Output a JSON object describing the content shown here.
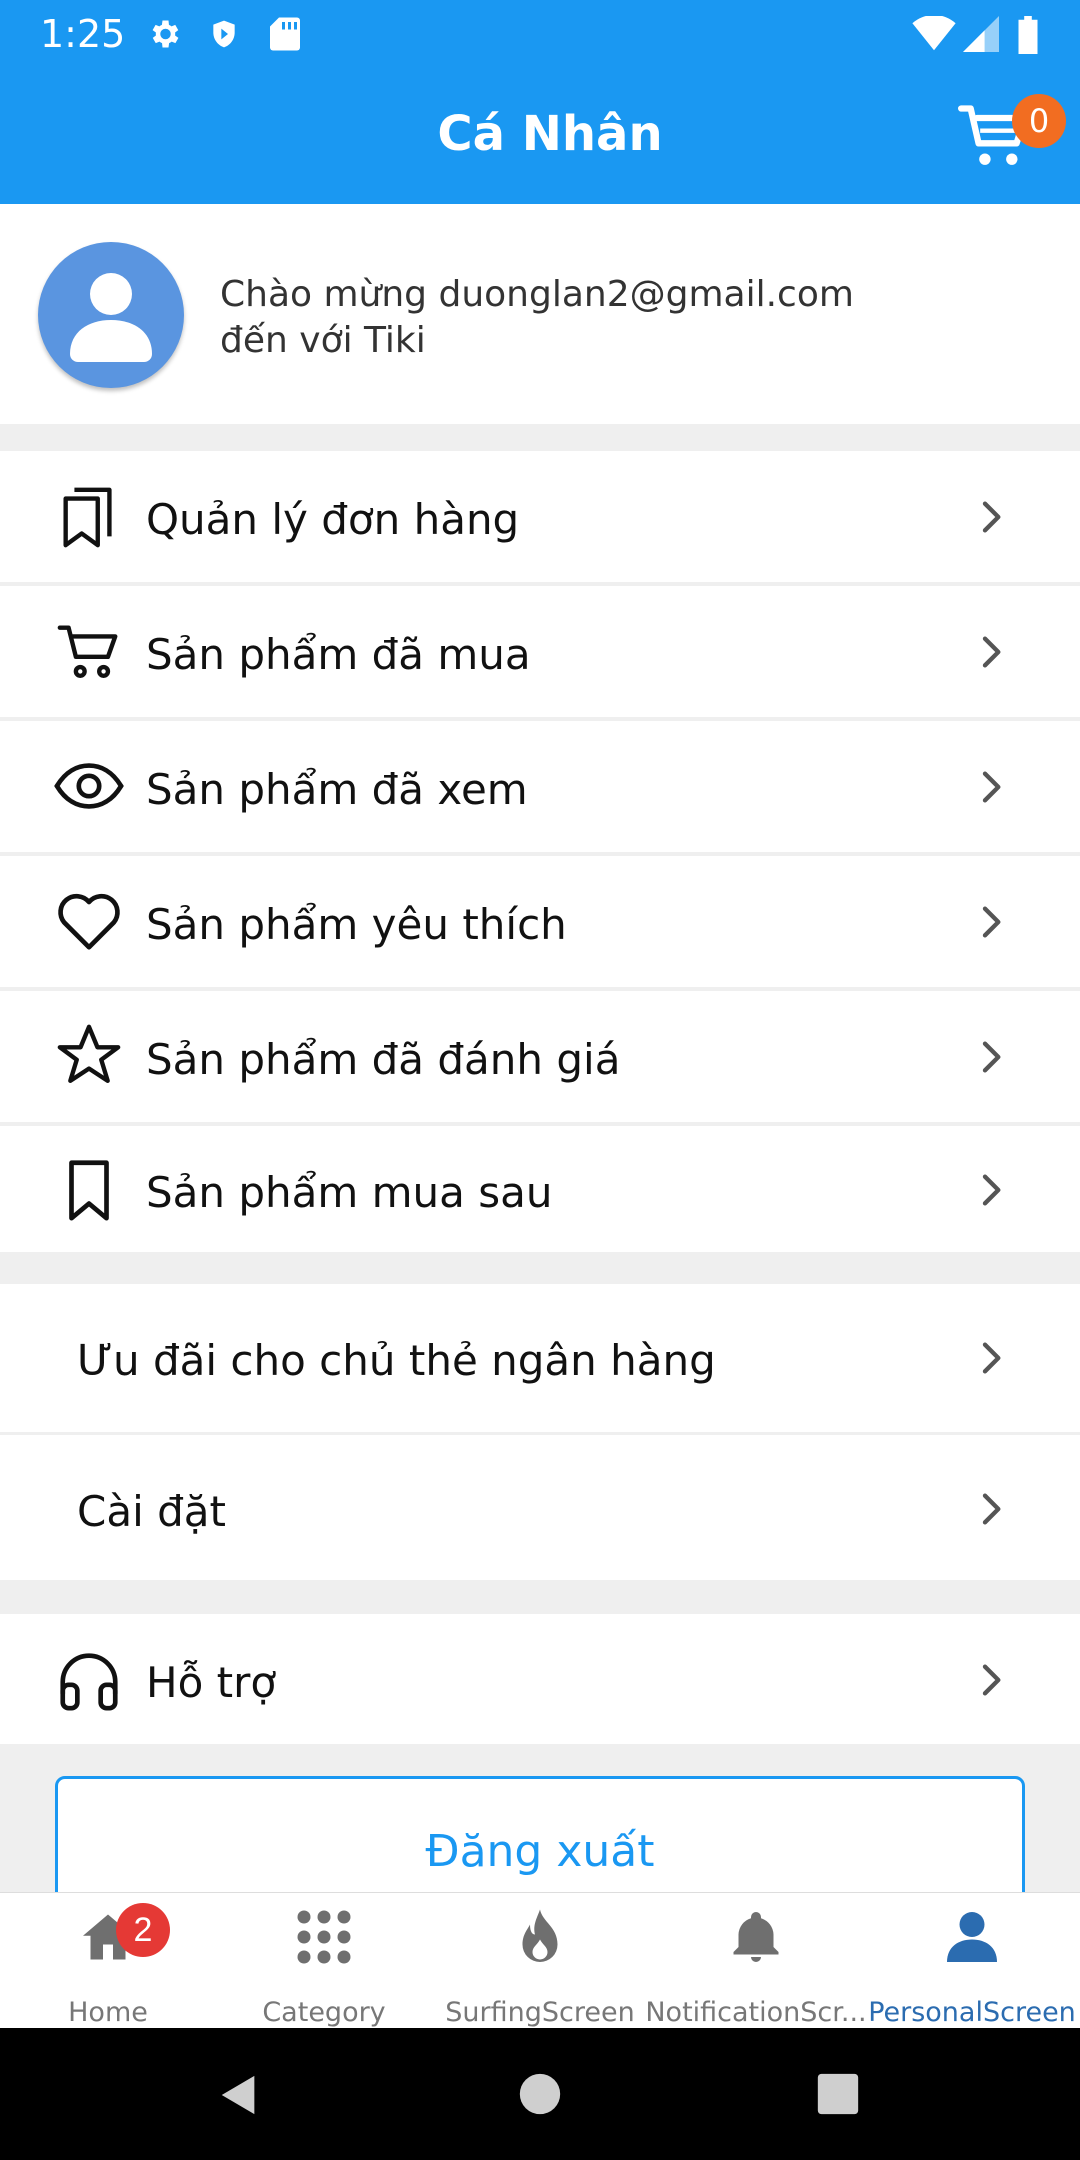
{
  "status_bar": {
    "time": "1:25",
    "left_icons": [
      "settings-icon",
      "shield-icon",
      "sd-card-icon"
    ],
    "right_icons": [
      "wifi-icon",
      "signal-icon",
      "battery-icon"
    ]
  },
  "header": {
    "title": "Cá Nhân",
    "cart_count": "0",
    "color": "#1a98f2"
  },
  "profile": {
    "welcome_line1": "Chào mừng duonglan2@gmail.com",
    "welcome_line2": "đến với Tiki"
  },
  "menu": {
    "orders": "Quản lý đơn hàng",
    "purchased": "Sản phẩm đã mua",
    "viewed": "Sản phẩm đã xem",
    "favorites": "Sản phẩm yêu thích",
    "reviewed": "Sản phẩm đã đánh giá",
    "buy_later": "Sản phẩm mua sau",
    "bank_offers": "Ưu đãi cho chủ thẻ ngân hàng",
    "settings": "Cài đặt",
    "support": "Hỗ trợ"
  },
  "logout_label": "Đăng xuất",
  "tabs": {
    "home": "Home",
    "home_badge": "2",
    "category": "Category",
    "surfing": "SurfingScreen",
    "notification": "NotificationScr...",
    "personal": "PersonalScreen",
    "active": "PersonalScreen"
  },
  "colors": {
    "accent": "#1a98f2",
    "cart_badge": "#f26d21",
    "tab_badge": "#e53935",
    "active_tab": "#2b6cb0"
  }
}
